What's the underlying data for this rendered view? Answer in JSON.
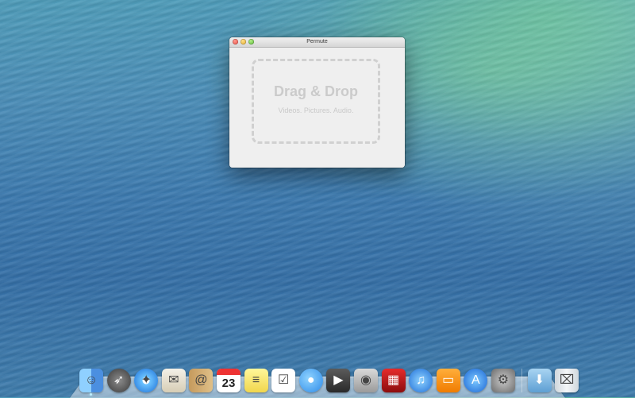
{
  "window": {
    "title": "Permute",
    "dropzone": {
      "title": "Drag & Drop",
      "subtitle": "Videos. Pictures. Audio."
    }
  },
  "calendar_icon": {
    "day": "23"
  },
  "dock": {
    "items": [
      {
        "name": "finder",
        "icon": "finder-icon",
        "running": true
      },
      {
        "name": "launchpad",
        "icon": "rocket-icon"
      },
      {
        "name": "safari",
        "icon": "compass-icon"
      },
      {
        "name": "mail",
        "icon": "stamp-icon"
      },
      {
        "name": "contacts",
        "icon": "address-book-icon"
      },
      {
        "name": "calendar",
        "icon": "calendar-icon"
      },
      {
        "name": "notes",
        "icon": "notepad-icon"
      },
      {
        "name": "reminders",
        "icon": "checklist-icon"
      },
      {
        "name": "messages",
        "icon": "speech-bubble-icon"
      },
      {
        "name": "facetime",
        "icon": "video-camera-icon"
      },
      {
        "name": "photo-booth",
        "icon": "camera-icon"
      },
      {
        "name": "photo-booth-red",
        "icon": "photo-strip-icon"
      },
      {
        "name": "itunes",
        "icon": "music-note-icon"
      },
      {
        "name": "ibooks",
        "icon": "book-icon"
      },
      {
        "name": "app-store",
        "icon": "app-store-icon"
      },
      {
        "name": "system-preferences",
        "icon": "gear-icon"
      },
      {
        "name": "downloads",
        "icon": "downloads-folder-icon"
      },
      {
        "name": "trash",
        "icon": "trash-icon"
      }
    ]
  }
}
